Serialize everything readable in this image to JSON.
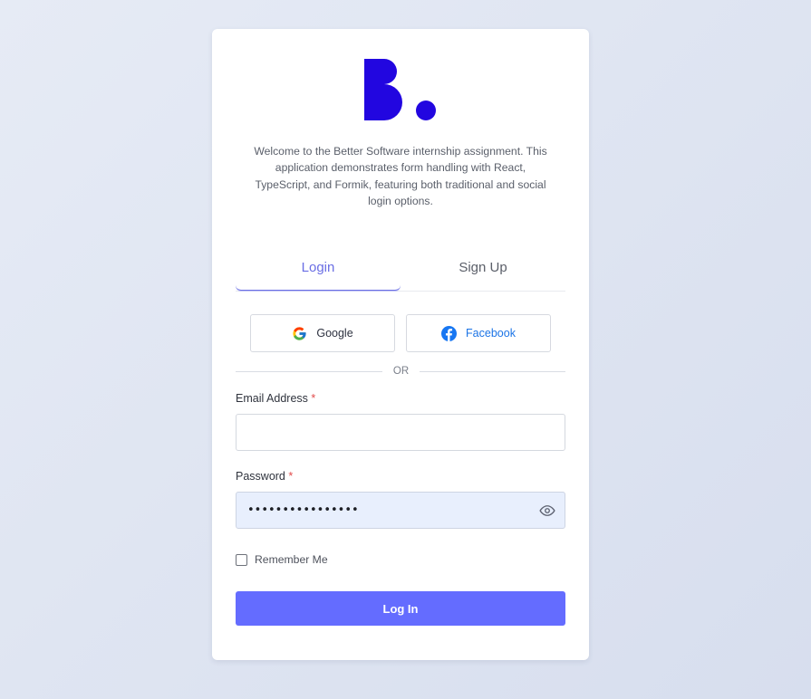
{
  "brand": {
    "logo_name": "better-software-logo",
    "color": "#2206e0"
  },
  "intro": {
    "text": "Welcome to the Better Software internship assignment. This application demonstrates form handling with React, TypeScript, and Formik, featuring both traditional and social login options."
  },
  "tabs": [
    {
      "label": "Login",
      "active": true
    },
    {
      "label": "Sign Up",
      "active": false
    }
  ],
  "social": {
    "google_label": "Google",
    "facebook_label": "Facebook"
  },
  "divider": {
    "label": "OR"
  },
  "form": {
    "email_label": "Email Address",
    "email_value": "",
    "password_label": "Password",
    "password_value": "••••••••••••••••",
    "required_marker": "*",
    "remember_label": "Remember Me",
    "remember_checked": false,
    "submit_label": "Log In"
  },
  "colors": {
    "accent": "#646cff",
    "tab_active": "#6a6ee4",
    "required": "#e24b4b",
    "facebook": "#1c74e6"
  }
}
